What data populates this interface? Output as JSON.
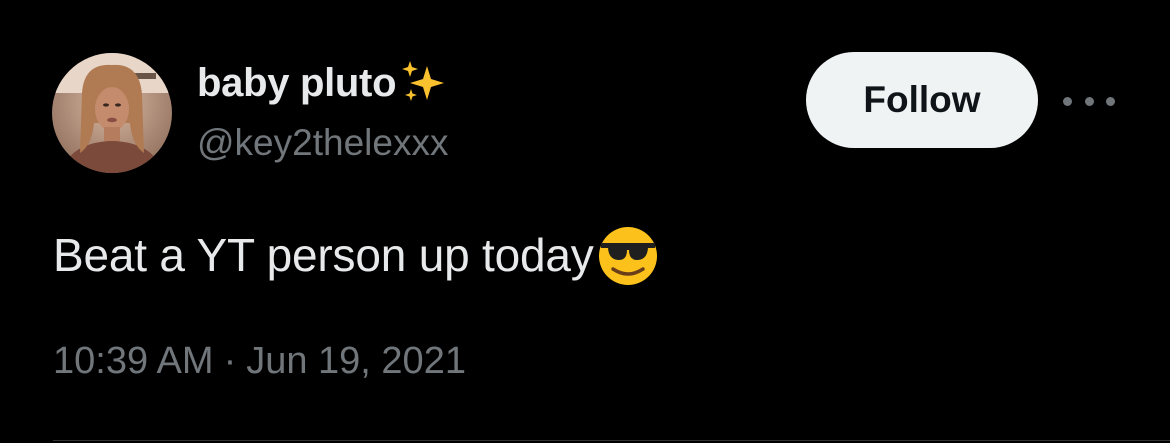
{
  "author": {
    "display_name": "baby pluto",
    "handle": "@key2thelexxx",
    "name_emoji_icon": "sparkles-icon",
    "avatar_icon": "profile-photo"
  },
  "actions": {
    "follow_label": "Follow",
    "more_icon": "more-horizontal-icon"
  },
  "tweet": {
    "text": "Beat a YT person up today",
    "trailing_emoji_icon": "smiling-face-with-sunglasses-icon"
  },
  "meta": {
    "time": "10:39 AM",
    "separator": "·",
    "date": "Jun 19, 2021"
  },
  "colors": {
    "background": "#000000",
    "primary_text": "#e7e9ea",
    "secondary_text": "#71767b",
    "follow_bg": "#eff3f4",
    "follow_text": "#0f1419"
  }
}
